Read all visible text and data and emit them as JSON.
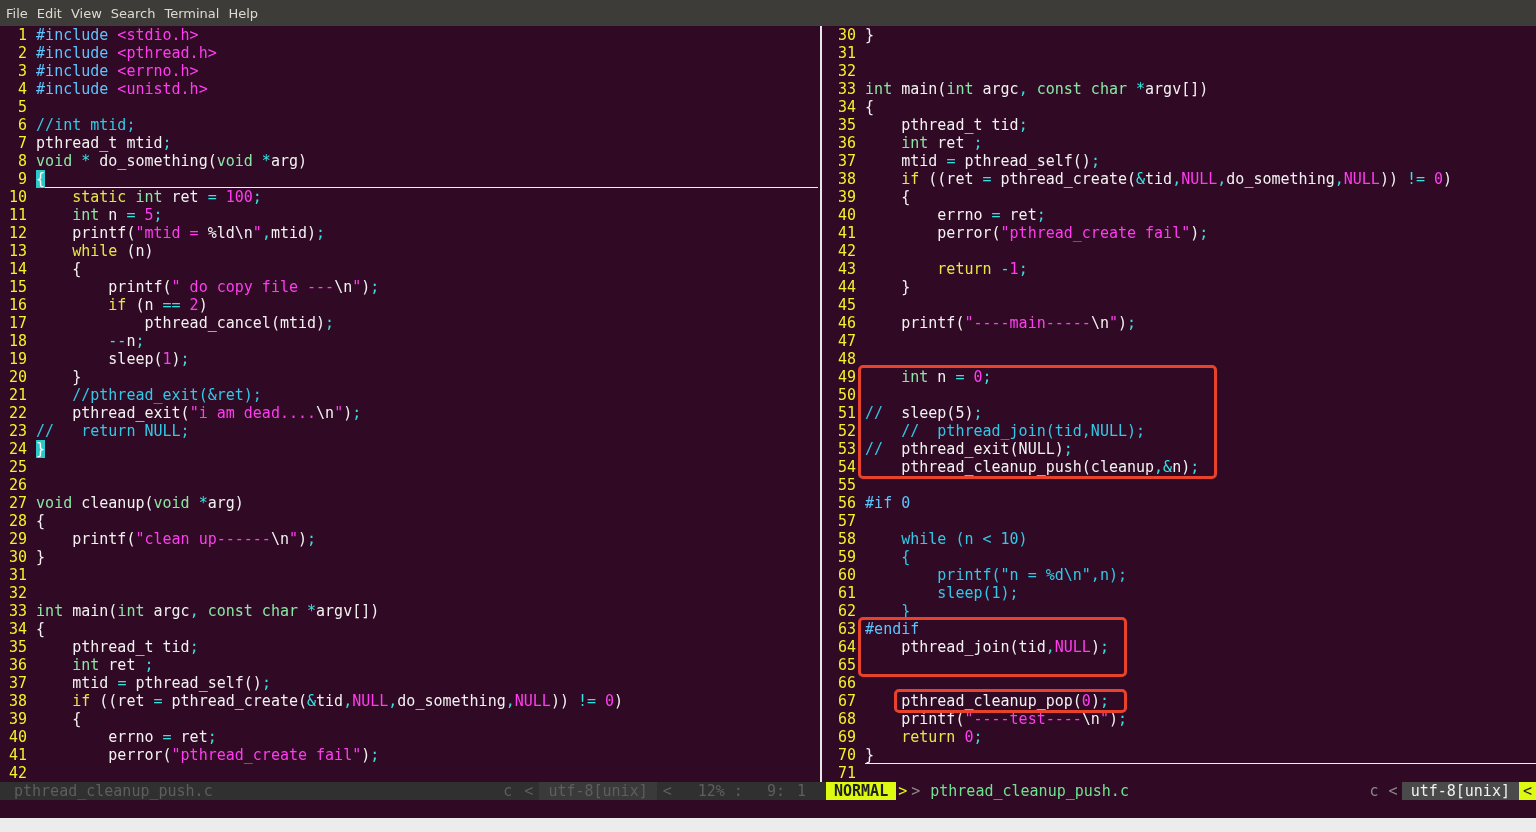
{
  "menu": [
    {
      "label": "File"
    },
    {
      "label": "Edit"
    },
    {
      "label": "View"
    },
    {
      "label": "Search"
    },
    {
      "label": "Terminal"
    },
    {
      "label": "Help"
    }
  ],
  "panes": [
    {
      "lines": [
        {
          "number": "1",
          "cursorline": false,
          "boxed": false,
          "segments": [
            {
              "kind": "preproc",
              "text": "#include"
            },
            {
              "kind": "string",
              "text": " <stdio.h>"
            }
          ]
        },
        {
          "number": "2",
          "cursorline": false,
          "boxed": false,
          "segments": [
            {
              "kind": "preproc",
              "text": "#include"
            },
            {
              "kind": "string",
              "text": " <pthread.h>"
            }
          ]
        },
        {
          "number": "3",
          "cursorline": false,
          "boxed": false,
          "segments": [
            {
              "kind": "preproc",
              "text": "#include"
            },
            {
              "kind": "string",
              "text": " <errno.h>"
            }
          ]
        },
        {
          "number": "4",
          "cursorline": false,
          "boxed": false,
          "segments": [
            {
              "kind": "preproc",
              "text": "#include"
            },
            {
              "kind": "string",
              "text": " <unistd.h>"
            }
          ]
        },
        {
          "number": "5",
          "cursorline": false,
          "boxed": false
        },
        {
          "number": "6",
          "cursorline": false,
          "boxed": false,
          "segments": [
            {
              "kind": "comment",
              "text": "//int mtid;"
            }
          ]
        },
        {
          "number": "7",
          "cursorline": false,
          "boxed": false,
          "segments": [
            {
              "kind": "plain",
              "text": "pthread_t mtid"
            },
            {
              "kind": "operator",
              "text": ";"
            }
          ]
        },
        {
          "number": "8",
          "cursorline": false,
          "boxed": false,
          "segments": [
            {
              "kind": "type",
              "text": "void"
            },
            {
              "kind": "operator",
              "text": " *"
            },
            {
              "kind": "plain",
              "text": " do_something("
            },
            {
              "kind": "type",
              "text": "void"
            },
            {
              "kind": "operator",
              "text": " *"
            },
            {
              "kind": "plain",
              "text": "arg)"
            }
          ]
        },
        {
          "number": "9",
          "cursorline": true,
          "boxed": false,
          "segments": [
            {
              "kind": "cursor",
              "text": "{"
            }
          ]
        },
        {
          "number": "10",
          "cursorline": false,
          "boxed": false,
          "segments": [
            {
              "kind": "keyword",
              "text": "    static"
            },
            {
              "kind": "type",
              "text": " int"
            },
            {
              "kind": "plain",
              "text": " ret "
            },
            {
              "kind": "operator",
              "text": "="
            },
            {
              "kind": "number",
              "text": " 100"
            },
            {
              "kind": "operator",
              "text": ";"
            }
          ]
        },
        {
          "number": "11",
          "cursorline": false,
          "boxed": false,
          "segments": [
            {
              "kind": "type",
              "text": "    int"
            },
            {
              "kind": "plain",
              "text": " n "
            },
            {
              "kind": "operator",
              "text": "="
            },
            {
              "kind": "number",
              "text": " 5"
            },
            {
              "kind": "operator",
              "text": ";"
            }
          ]
        },
        {
          "number": "12",
          "cursorline": false,
          "boxed": false,
          "segments": [
            {
              "kind": "plain",
              "text": "    printf("
            },
            {
              "kind": "string",
              "text": "\"mtid = "
            },
            {
              "kind": "plain",
              "text": "%ld\\n"
            },
            {
              "kind": "string",
              "text": "\""
            },
            {
              "kind": "operator",
              "text": ","
            },
            {
              "kind": "plain",
              "text": "mtid)"
            },
            {
              "kind": "operator",
              "text": ";"
            }
          ]
        },
        {
          "number": "13",
          "cursorline": false,
          "boxed": false,
          "segments": [
            {
              "kind": "keyword",
              "text": "    while"
            },
            {
              "kind": "plain",
              "text": " (n)"
            }
          ]
        },
        {
          "number": "14",
          "cursorline": false,
          "boxed": false,
          "segments": [
            {
              "kind": "plain",
              "text": "    {"
            }
          ]
        },
        {
          "number": "15",
          "cursorline": false,
          "boxed": false,
          "segments": [
            {
              "kind": "plain",
              "text": "        printf("
            },
            {
              "kind": "string",
              "text": "\" do copy file ---"
            },
            {
              "kind": "plain",
              "text": "\\n"
            },
            {
              "kind": "string",
              "text": "\""
            },
            {
              "kind": "plain",
              "text": ")"
            },
            {
              "kind": "operator",
              "text": ";"
            }
          ]
        },
        {
          "number": "16",
          "cursorline": false,
          "boxed": false,
          "segments": [
            {
              "kind": "keyword",
              "text": "        if"
            },
            {
              "kind": "plain",
              "text": " (n "
            },
            {
              "kind": "operator",
              "text": "=="
            },
            {
              "kind": "number",
              "text": " 2"
            },
            {
              "kind": "plain",
              "text": ")"
            }
          ]
        },
        {
          "number": "17",
          "cursorline": false,
          "boxed": false,
          "segments": [
            {
              "kind": "plain",
              "text": "            pthread_cancel(mtid)"
            },
            {
              "kind": "operator",
              "text": ";"
            }
          ]
        },
        {
          "number": "18",
          "cursorline": false,
          "boxed": false,
          "segments": [
            {
              "kind": "operator",
              "text": "        --"
            },
            {
              "kind": "plain",
              "text": "n"
            },
            {
              "kind": "operator",
              "text": ";"
            }
          ]
        },
        {
          "number": "19",
          "cursorline": false,
          "boxed": false,
          "segments": [
            {
              "kind": "plain",
              "text": "        sleep("
            },
            {
              "kind": "number",
              "text": "1"
            },
            {
              "kind": "plain",
              "text": ")"
            },
            {
              "kind": "operator",
              "text": ";"
            }
          ]
        },
        {
          "number": "20",
          "cursorline": false,
          "boxed": false,
          "segments": [
            {
              "kind": "plain",
              "text": "    }"
            }
          ]
        },
        {
          "number": "21",
          "cursorline": false,
          "boxed": false,
          "segments": [
            {
              "kind": "comment",
              "text": "    //pthread_exit(&ret);"
            }
          ]
        },
        {
          "number": "22",
          "cursorline": false,
          "boxed": false,
          "segments": [
            {
              "kind": "plain",
              "text": "    pthread_exit("
            },
            {
              "kind": "string",
              "text": "\"i am dead...."
            },
            {
              "kind": "plain",
              "text": "\\n"
            },
            {
              "kind": "string",
              "text": "\""
            },
            {
              "kind": "plain",
              "text": ")"
            },
            {
              "kind": "operator",
              "text": ";"
            }
          ]
        },
        {
          "number": "23",
          "cursorline": false,
          "boxed": false,
          "segments": [
            {
              "kind": "comment",
              "text": "//   return NULL;"
            }
          ]
        },
        {
          "number": "24",
          "cursorline": false,
          "boxed": false,
          "segments": [
            {
              "kind": "cursor",
              "text": "}"
            }
          ]
        },
        {
          "number": "25",
          "cursorline": false,
          "boxed": false
        },
        {
          "number": "26",
          "cursorline": false,
          "boxed": false
        },
        {
          "number": "27",
          "cursorline": false,
          "boxed": false,
          "segments": [
            {
              "kind": "type",
              "text": "void"
            },
            {
              "kind": "plain",
              "text": " cleanup("
            },
            {
              "kind": "type",
              "text": "void"
            },
            {
              "kind": "operator",
              "text": " *"
            },
            {
              "kind": "plain",
              "text": "arg)"
            }
          ]
        },
        {
          "number": "28",
          "cursorline": false,
          "boxed": false,
          "segments": [
            {
              "kind": "plain",
              "text": "{"
            }
          ]
        },
        {
          "number": "29",
          "cursorline": false,
          "boxed": false,
          "segments": [
            {
              "kind": "plain",
              "text": "    printf("
            },
            {
              "kind": "string",
              "text": "\"clean up------"
            },
            {
              "kind": "plain",
              "text": "\\n"
            },
            {
              "kind": "string",
              "text": "\""
            },
            {
              "kind": "plain",
              "text": ")"
            },
            {
              "kind": "operator",
              "text": ";"
            }
          ]
        },
        {
          "number": "30",
          "cursorline": false,
          "boxed": false,
          "segments": [
            {
              "kind": "plain",
              "text": "}"
            }
          ]
        },
        {
          "number": "31",
          "cursorline": false,
          "boxed": false
        },
        {
          "number": "32",
          "cursorline": false,
          "boxed": false
        },
        {
          "number": "33",
          "cursorline": false,
          "boxed": false,
          "segments": [
            {
              "kind": "type",
              "text": "int"
            },
            {
              "kind": "plain",
              "text": " main("
            },
            {
              "kind": "type",
              "text": "int"
            },
            {
              "kind": "plain",
              "text": " argc"
            },
            {
              "kind": "operator",
              "text": ","
            },
            {
              "kind": "type",
              "text": " const char"
            },
            {
              "kind": "operator",
              "text": " *"
            },
            {
              "kind": "plain",
              "text": "argv[])"
            }
          ]
        },
        {
          "number": "34",
          "cursorline": false,
          "boxed": false,
          "segments": [
            {
              "kind": "plain",
              "text": "{"
            }
          ]
        },
        {
          "number": "35",
          "cursorline": false,
          "boxed": false,
          "segments": [
            {
              "kind": "plain",
              "text": "    pthread_t tid"
            },
            {
              "kind": "operator",
              "text": ";"
            }
          ]
        },
        {
          "number": "36",
          "cursorline": false,
          "boxed": false,
          "segments": [
            {
              "kind": "type",
              "text": "    int"
            },
            {
              "kind": "plain",
              "text": " ret "
            },
            {
              "kind": "operator",
              "text": ";"
            }
          ]
        },
        {
          "number": "37",
          "cursorline": false,
          "boxed": false,
          "segments": [
            {
              "kind": "plain",
              "text": "    mtid "
            },
            {
              "kind": "operator",
              "text": "="
            },
            {
              "kind": "plain",
              "text": " pthread_self()"
            },
            {
              "kind": "operator",
              "text": ";"
            }
          ]
        },
        {
          "number": "38",
          "cursorline": false,
          "boxed": false,
          "segments": [
            {
              "kind": "keyword",
              "text": "    if"
            },
            {
              "kind": "plain",
              "text": " ((ret "
            },
            {
              "kind": "operator",
              "text": "="
            },
            {
              "kind": "plain",
              "text": " pthread_create("
            },
            {
              "kind": "operator",
              "text": "&"
            },
            {
              "kind": "plain",
              "text": "tid"
            },
            {
              "kind": "operator",
              "text": ","
            },
            {
              "kind": "string",
              "text": "NULL"
            },
            {
              "kind": "operator",
              "text": ","
            },
            {
              "kind": "plain",
              "text": "do_something"
            },
            {
              "kind": "operator",
              "text": ","
            },
            {
              "kind": "string",
              "text": "NULL"
            },
            {
              "kind": "plain",
              "text": ")) "
            },
            {
              "kind": "operator",
              "text": "!="
            },
            {
              "kind": "number",
              "text": " 0"
            },
            {
              "kind": "plain",
              "text": ")"
            }
          ]
        },
        {
          "number": "39",
          "cursorline": false,
          "boxed": false,
          "segments": [
            {
              "kind": "plain",
              "text": "    {"
            }
          ]
        },
        {
          "number": "40",
          "cursorline": false,
          "boxed": false,
          "segments": [
            {
              "kind": "plain",
              "text": "        errno "
            },
            {
              "kind": "operator",
              "text": "="
            },
            {
              "kind": "plain",
              "text": " ret"
            },
            {
              "kind": "operator",
              "text": ";"
            }
          ]
        },
        {
          "number": "41",
          "cursorline": false,
          "boxed": false,
          "segments": [
            {
              "kind": "plain",
              "text": "        perror("
            },
            {
              "kind": "string",
              "text": "\"pthread_create fail\""
            },
            {
              "kind": "plain",
              "text": ")"
            },
            {
              "kind": "operator",
              "text": ";"
            }
          ]
        },
        {
          "number": "42",
          "cursorline": false,
          "boxed": false
        }
      ]
    },
    {
      "lines": [
        {
          "number": "30",
          "cursorline": false,
          "boxed": false,
          "segments": [
            {
              "kind": "plain",
              "text": "}"
            }
          ]
        },
        {
          "number": "31",
          "cursorline": false,
          "boxed": false
        },
        {
          "number": "32",
          "cursorline": false,
          "boxed": false
        },
        {
          "number": "33",
          "cursorline": false,
          "boxed": false,
          "segments": [
            {
              "kind": "type",
              "text": "int"
            },
            {
              "kind": "plain",
              "text": " main("
            },
            {
              "kind": "type",
              "text": "int"
            },
            {
              "kind": "plain",
              "text": " argc"
            },
            {
              "kind": "operator",
              "text": ","
            },
            {
              "kind": "type",
              "text": " const char"
            },
            {
              "kind": "operator",
              "text": " *"
            },
            {
              "kind": "plain",
              "text": "argv[])"
            }
          ]
        },
        {
          "number": "34",
          "cursorline": false,
          "boxed": false,
          "segments": [
            {
              "kind": "plain",
              "text": "{"
            }
          ]
        },
        {
          "number": "35",
          "cursorline": false,
          "boxed": false,
          "segments": [
            {
              "kind": "plain",
              "text": "    pthread_t tid"
            },
            {
              "kind": "operator",
              "text": ";"
            }
          ]
        },
        {
          "number": "36",
          "cursorline": false,
          "boxed": false,
          "segments": [
            {
              "kind": "type",
              "text": "    int"
            },
            {
              "kind": "plain",
              "text": " ret "
            },
            {
              "kind": "operator",
              "text": ";"
            }
          ]
        },
        {
          "number": "37",
          "cursorline": false,
          "boxed": false,
          "segments": [
            {
              "kind": "plain",
              "text": "    mtid "
            },
            {
              "kind": "operator",
              "text": "="
            },
            {
              "kind": "plain",
              "text": " pthread_self()"
            },
            {
              "kind": "operator",
              "text": ";"
            }
          ]
        },
        {
          "number": "38",
          "cursorline": false,
          "boxed": false,
          "segments": [
            {
              "kind": "keyword",
              "text": "    if"
            },
            {
              "kind": "plain",
              "text": " ((ret "
            },
            {
              "kind": "operator",
              "text": "="
            },
            {
              "kind": "plain",
              "text": " pthread_create("
            },
            {
              "kind": "operator",
              "text": "&"
            },
            {
              "kind": "plain",
              "text": "tid"
            },
            {
              "kind": "operator",
              "text": ","
            },
            {
              "kind": "string",
              "text": "NULL"
            },
            {
              "kind": "operator",
              "text": ","
            },
            {
              "kind": "plain",
              "text": "do_something"
            },
            {
              "kind": "operator",
              "text": ","
            },
            {
              "kind": "string",
              "text": "NULL"
            },
            {
              "kind": "plain",
              "text": ")) "
            },
            {
              "kind": "operator",
              "text": "!="
            },
            {
              "kind": "number",
              "text": " 0"
            },
            {
              "kind": "plain",
              "text": ")"
            }
          ]
        },
        {
          "number": "39",
          "cursorline": false,
          "boxed": false,
          "segments": [
            {
              "kind": "plain",
              "text": "    {"
            }
          ]
        },
        {
          "number": "40",
          "cursorline": false,
          "boxed": false,
          "segments": [
            {
              "kind": "plain",
              "text": "        errno "
            },
            {
              "kind": "operator",
              "text": "="
            },
            {
              "kind": "plain",
              "text": " ret"
            },
            {
              "kind": "operator",
              "text": ";"
            }
          ]
        },
        {
          "number": "41",
          "cursorline": false,
          "boxed": false,
          "segments": [
            {
              "kind": "plain",
              "text": "        perror("
            },
            {
              "kind": "string",
              "text": "\"pthread_create fail\""
            },
            {
              "kind": "plain",
              "text": ")"
            },
            {
              "kind": "operator",
              "text": ";"
            }
          ]
        },
        {
          "number": "42",
          "cursorline": false,
          "boxed": false
        },
        {
          "number": "43",
          "cursorline": false,
          "boxed": false,
          "segments": [
            {
              "kind": "keyword",
              "text": "        return"
            },
            {
              "kind": "operator",
              "text": " -"
            },
            {
              "kind": "number",
              "text": "1"
            },
            {
              "kind": "operator",
              "text": ";"
            }
          ]
        },
        {
          "number": "44",
          "cursorline": false,
          "boxed": false,
          "segments": [
            {
              "kind": "plain",
              "text": "    }"
            }
          ]
        },
        {
          "number": "45",
          "cursorline": false,
          "boxed": false
        },
        {
          "number": "46",
          "cursorline": false,
          "boxed": false,
          "segments": [
            {
              "kind": "plain",
              "text": "    printf("
            },
            {
              "kind": "string",
              "text": "\"----main-----"
            },
            {
              "kind": "plain",
              "text": "\\n"
            },
            {
              "kind": "string",
              "text": "\""
            },
            {
              "kind": "plain",
              "text": ")"
            },
            {
              "kind": "operator",
              "text": ";"
            }
          ]
        },
        {
          "number": "47",
          "cursorline": false,
          "boxed": false
        },
        {
          "number": "48",
          "cursorline": false,
          "boxed": false
        },
        {
          "number": "49",
          "cursorline": false,
          "boxed": true,
          "segments": [
            {
              "kind": "type",
              "text": "    int"
            },
            {
              "kind": "plain",
              "text": " n "
            },
            {
              "kind": "operator",
              "text": "="
            },
            {
              "kind": "number",
              "text": " 0"
            },
            {
              "kind": "operator",
              "text": ";"
            }
          ]
        },
        {
          "number": "50",
          "cursorline": false,
          "boxed": true
        },
        {
          "number": "51",
          "cursorline": false,
          "boxed": true,
          "segments": [
            {
              "kind": "comment",
              "text": "//"
            },
            {
              "kind": "plain",
              "text": "  sleep(5)"
            },
            {
              "kind": "operator",
              "text": ";"
            }
          ]
        },
        {
          "number": "52",
          "cursorline": false,
          "boxed": true,
          "segments": [
            {
              "kind": "comment",
              "text": "    //  pthread_join(tid,NULL);"
            }
          ]
        },
        {
          "number": "53",
          "cursorline": false,
          "boxed": true,
          "segments": [
            {
              "kind": "comment",
              "text": "//"
            },
            {
              "kind": "plain",
              "text": "  pthread_exit(NULL)"
            },
            {
              "kind": "operator",
              "text": ";"
            }
          ]
        },
        {
          "number": "54",
          "cursorline": false,
          "boxed": true,
          "segments": [
            {
              "kind": "plain",
              "text": "    pthread_cleanup_push(cleanup"
            },
            {
              "kind": "operator",
              "text": ",&"
            },
            {
              "kind": "plain",
              "text": "n)"
            },
            {
              "kind": "operator",
              "text": ";"
            }
          ]
        },
        {
          "number": "55",
          "cursorline": false,
          "boxed": false
        },
        {
          "number": "56",
          "cursorline": false,
          "boxed": false,
          "segments": [
            {
              "kind": "preproc",
              "text": "#if 0"
            }
          ]
        },
        {
          "number": "57",
          "cursorline": false,
          "boxed": false
        },
        {
          "number": "58",
          "cursorline": false,
          "boxed": false,
          "segments": [
            {
              "kind": "comment",
              "text": "    while (n < 10)"
            }
          ]
        },
        {
          "number": "59",
          "cursorline": false,
          "boxed": false,
          "segments": [
            {
              "kind": "comment",
              "text": "    {"
            }
          ]
        },
        {
          "number": "60",
          "cursorline": false,
          "boxed": false,
          "segments": [
            {
              "kind": "comment",
              "text": "        printf(\"n = %d\\n\",n);"
            }
          ]
        },
        {
          "number": "61",
          "cursorline": false,
          "boxed": false,
          "segments": [
            {
              "kind": "comment",
              "text": "        sleep(1);"
            }
          ]
        },
        {
          "number": "62",
          "cursorline": false,
          "boxed": false,
          "segments": [
            {
              "kind": "comment",
              "text": "    }"
            }
          ]
        },
        {
          "number": "63",
          "cursorline": false,
          "boxed": true,
          "segments": [
            {
              "kind": "preproc",
              "text": "#endif"
            }
          ]
        },
        {
          "number": "64",
          "cursorline": false,
          "boxed": true,
          "segments": [
            {
              "kind": "plain",
              "text": "    pthread_join(tid"
            },
            {
              "kind": "operator",
              "text": ","
            },
            {
              "kind": "string",
              "text": "NULL"
            },
            {
              "kind": "plain",
              "text": ")"
            },
            {
              "kind": "operator",
              "text": ";"
            }
          ]
        },
        {
          "number": "65",
          "cursorline": false,
          "boxed": true
        },
        {
          "number": "66",
          "cursorline": false,
          "boxed": false
        },
        {
          "number": "67",
          "cursorline": false,
          "boxed": true,
          "segments": [
            {
              "kind": "plain",
              "text": "    pthread_cleanup_pop("
            },
            {
              "kind": "number",
              "text": "0"
            },
            {
              "kind": "plain",
              "text": ")"
            },
            {
              "kind": "operator",
              "text": ";"
            }
          ]
        },
        {
          "number": "68",
          "cursorline": false,
          "boxed": false,
          "segments": [
            {
              "kind": "plain",
              "text": "    printf("
            },
            {
              "kind": "string",
              "text": "\"----test----"
            },
            {
              "kind": "plain",
              "text": "\\n"
            },
            {
              "kind": "string",
              "text": "\""
            },
            {
              "kind": "plain",
              "text": ")"
            },
            {
              "kind": "operator",
              "text": ";"
            }
          ]
        },
        {
          "number": "69",
          "cursorline": false,
          "boxed": false,
          "segments": [
            {
              "kind": "keyword",
              "text": "    return"
            },
            {
              "kind": "number",
              "text": " 0"
            },
            {
              "kind": "operator",
              "text": ";"
            }
          ]
        },
        {
          "number": "70",
          "cursorline": true,
          "boxed": false,
          "segments": [
            {
              "kind": "plain",
              "text": "}"
            }
          ]
        },
        {
          "number": "71",
          "cursorline": false,
          "boxed": false
        }
      ]
    }
  ],
  "status_bars": [
    {
      "active": false,
      "segments": [
        {
          "kind": "file",
          "text": "pthread_cleanup_push.c"
        },
        {
          "kind": "filetype",
          "text": "c"
        },
        {
          "kind": "separator",
          "text": "<"
        },
        {
          "kind": "encoding",
          "text": "utf-8[unix]"
        },
        {
          "kind": "separator",
          "text": "<"
        },
        {
          "kind": "percent",
          "text": "12% :"
        },
        {
          "kind": "line",
          "text": "9:"
        },
        {
          "kind": "column",
          "text": "1"
        }
      ]
    },
    {
      "active": true,
      "segments": [
        {
          "kind": "mode",
          "text": "NORMAL"
        },
        {
          "kind": "arrow",
          "text": ">"
        },
        {
          "kind": "separator",
          "text": ">"
        },
        {
          "kind": "file",
          "text": "pthread_cleanup_push.c"
        },
        {
          "kind": "filetype",
          "text": "c"
        },
        {
          "kind": "separator",
          "text": "<"
        },
        {
          "kind": "encoding",
          "text": "utf-8[unix]"
        },
        {
          "kind": "separator",
          "text": "<"
        }
      ]
    }
  ]
}
